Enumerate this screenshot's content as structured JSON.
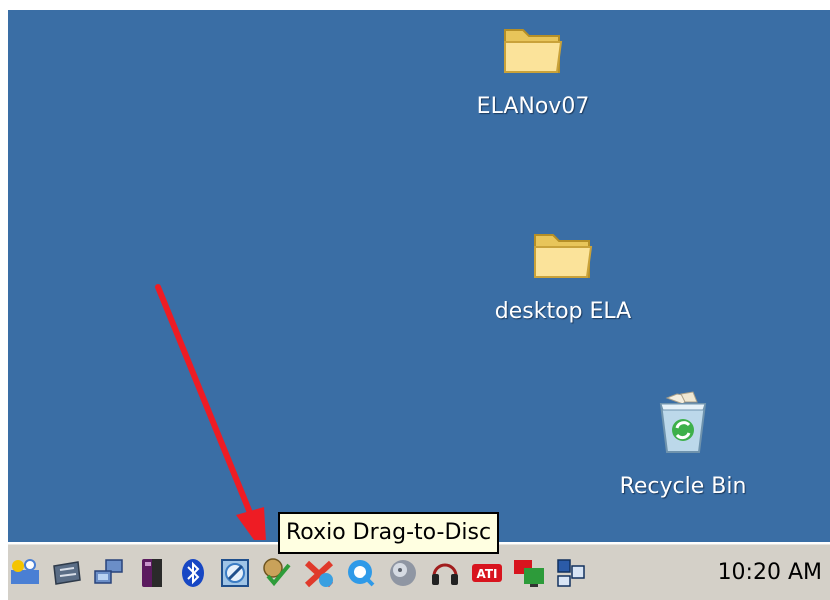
{
  "desktop": {
    "background_color": "#3a6ea5",
    "icons": [
      {
        "label": "ELANov07",
        "icon": "folder-icon"
      },
      {
        "label": "desktop ELA",
        "icon": "folder-icon"
      },
      {
        "label": "Recycle Bin",
        "icon": "recycle-bin-icon"
      }
    ]
  },
  "annotation": {
    "arrow_color": "#ee1c24"
  },
  "tooltip": {
    "text": "Roxio Drag-to-Disc"
  },
  "taskbar": {
    "background_color": "#d4d0c8",
    "tray_icons": [
      "network-wizard-icon",
      "drive-icon",
      "network-connection-icon",
      "usb-device-icon",
      "bluetooth-icon",
      "roxio-drag-to-disc-icon",
      "antivirus-check-icon",
      "tools-icon",
      "quicktime-icon",
      "media-disc-icon",
      "headset-icon",
      "ati-icon",
      "display-icon",
      "network-adapter-icon"
    ],
    "clock": "10:20 AM"
  }
}
